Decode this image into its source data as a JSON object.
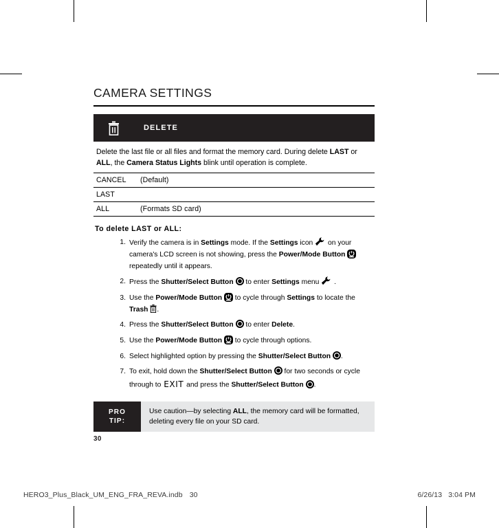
{
  "document": {
    "section_title": "CAMERA SETTINGS",
    "page_number": "30"
  },
  "mode_bar": {
    "icon": "trash-icon",
    "label": "DELETE"
  },
  "description": {
    "text_part_1": "Delete the last file or all files and format the memory card. During delete ",
    "bold_1": "LAST",
    "text_part_2": " or ",
    "bold_2": "ALL",
    "text_part_3": ", the ",
    "bold_3": "Camera Status Lights",
    "text_part_4": " blink until operation is complete."
  },
  "options": [
    {
      "name": "CANCEL",
      "note": "(Default)"
    },
    {
      "name": "LAST",
      "note": ""
    },
    {
      "name": "ALL",
      "note": "(Formats SD card)"
    }
  ],
  "steps_heading": "To delete LAST or ALL:",
  "steps": [
    {
      "number": "1.",
      "segments": [
        {
          "type": "text",
          "value": "Verify the camera is in "
        },
        {
          "type": "bold",
          "value": "Settings"
        },
        {
          "type": "text",
          "value": " mode. If the "
        },
        {
          "type": "bold",
          "value": "Settings"
        },
        {
          "type": "text",
          "value": " icon "
        },
        {
          "type": "icon",
          "value": "wrench-icon"
        },
        {
          "type": "text",
          "value": " on your camera's LCD screen is not showing, press the "
        },
        {
          "type": "bold",
          "value": "Power/Mode Button"
        },
        {
          "type": "text",
          "value": " "
        },
        {
          "type": "icon",
          "value": "power-mode-icon"
        },
        {
          "type": "text",
          "value": " repeatedly until it appears."
        }
      ]
    },
    {
      "number": "2.",
      "segments": [
        {
          "type": "text",
          "value": "Press the "
        },
        {
          "type": "bold",
          "value": "Shutter/Select Button"
        },
        {
          "type": "text",
          "value": " "
        },
        {
          "type": "icon",
          "value": "shutter-select-icon"
        },
        {
          "type": "text",
          "value": " to enter "
        },
        {
          "type": "bold",
          "value": "Settings"
        },
        {
          "type": "text",
          "value": " menu "
        },
        {
          "type": "icon",
          "value": "wrench-icon"
        },
        {
          "type": "text",
          "value": " ."
        }
      ]
    },
    {
      "number": "3.",
      "segments": [
        {
          "type": "text",
          "value": "Use the "
        },
        {
          "type": "bold",
          "value": "Power/Mode Button"
        },
        {
          "type": "text",
          "value": " "
        },
        {
          "type": "icon",
          "value": "power-mode-icon"
        },
        {
          "type": "text",
          "value": " to cycle through "
        },
        {
          "type": "bold",
          "value": "Settings"
        },
        {
          "type": "text",
          "value": " to locate the "
        },
        {
          "type": "bold",
          "value": "Trash"
        },
        {
          "type": "text",
          "value": " "
        },
        {
          "type": "icon",
          "value": "trash-icon"
        },
        {
          "type": "text",
          "value": "."
        }
      ]
    },
    {
      "number": "4.",
      "segments": [
        {
          "type": "text",
          "value": "Press the "
        },
        {
          "type": "bold",
          "value": "Shutter/Select Button"
        },
        {
          "type": "text",
          "value": " "
        },
        {
          "type": "icon",
          "value": "shutter-select-icon"
        },
        {
          "type": "text",
          "value": " to enter "
        },
        {
          "type": "bold",
          "value": "Delete"
        },
        {
          "type": "text",
          "value": "."
        }
      ]
    },
    {
      "number": "5.",
      "segments": [
        {
          "type": "text",
          "value": "Use the "
        },
        {
          "type": "bold",
          "value": "Power/Mode Button"
        },
        {
          "type": "text",
          "value": " "
        },
        {
          "type": "icon",
          "value": "power-mode-icon"
        },
        {
          "type": "text",
          "value": " to cycle through options."
        }
      ]
    },
    {
      "number": "6.",
      "segments": [
        {
          "type": "text",
          "value": "Select highlighted option by pressing the "
        },
        {
          "type": "bold",
          "value": "Shutter/Select Button"
        },
        {
          "type": "text",
          "value": " "
        },
        {
          "type": "icon",
          "value": "shutter-select-icon"
        },
        {
          "type": "text",
          "value": "."
        }
      ]
    },
    {
      "number": "7.",
      "segments": [
        {
          "type": "text",
          "value": "To exit, hold down the "
        },
        {
          "type": "bold",
          "value": "Shutter/Select Button"
        },
        {
          "type": "text",
          "value": " "
        },
        {
          "type": "icon",
          "value": "shutter-select-icon"
        },
        {
          "type": "text",
          "value": " for two seconds or cycle through to "
        },
        {
          "type": "exit",
          "value": "EXIT"
        },
        {
          "type": "text",
          "value": " and press the "
        },
        {
          "type": "bold",
          "value": "Shutter/Select Button"
        },
        {
          "type": "text",
          "value": " "
        },
        {
          "type": "icon",
          "value": "shutter-select-icon"
        },
        {
          "type": "text",
          "value": "."
        }
      ]
    }
  ],
  "pro_tip": {
    "tag_line_1": "PRO",
    "tag_line_2": "TIP:",
    "segments": [
      {
        "type": "text",
        "value": "Use caution—by selecting "
      },
      {
        "type": "bold",
        "value": "ALL"
      },
      {
        "type": "text",
        "value": ", the memory card will be formatted, deleting every file on your SD card."
      }
    ]
  },
  "footer": {
    "filename": "HERO3_Plus_Black_UM_ENG_FRA_REVA.indb",
    "page": "30",
    "date": "6/26/13",
    "time": "3:04 PM"
  },
  "colors": {
    "bar_black": "#231f20",
    "protip_gray": "#e6e7e8",
    "text": "#000000"
  }
}
